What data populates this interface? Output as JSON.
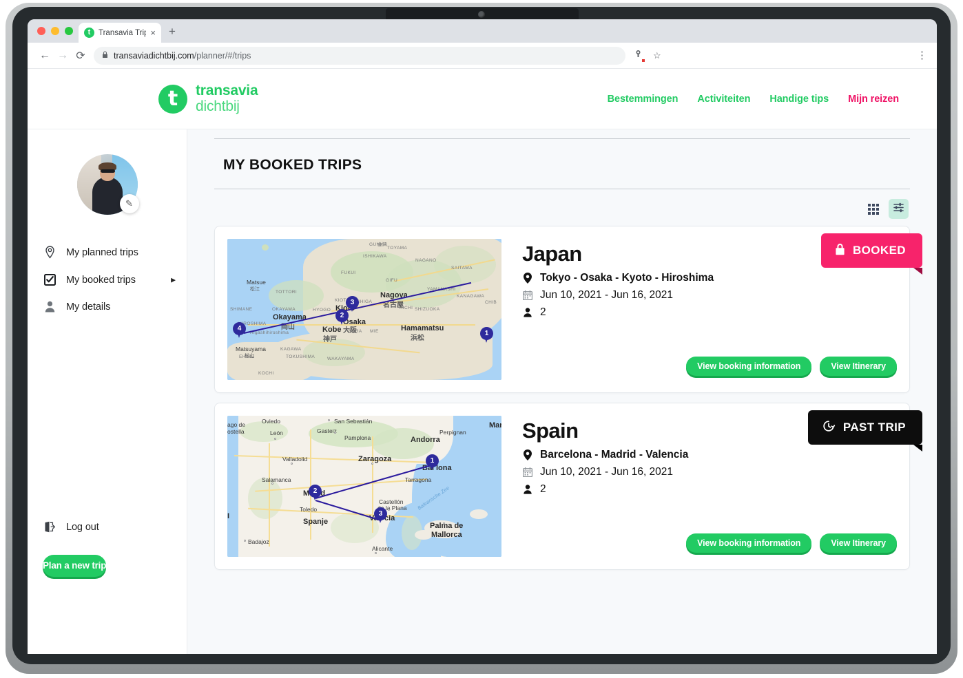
{
  "browser": {
    "tab_title": "Transavia Trip",
    "favicon_letter": "t",
    "tab_close": "×",
    "new_tab": "+",
    "back_icon": "←",
    "forward_icon": "→",
    "reload_icon": "⟳",
    "lock_icon": "🔒",
    "url_domain": "transaviadichtbij.com",
    "url_path": "/planner/#/trips",
    "star_icon": "☆",
    "menu_icon": "⋮"
  },
  "header": {
    "logo_line1": "transavia",
    "logo_line2": "dichtbij",
    "nav": [
      {
        "label": "Bestemmingen",
        "active": false
      },
      {
        "label": "Activiteiten",
        "active": false
      },
      {
        "label": "Handige tips",
        "active": false
      },
      {
        "label": "Mijn reizen",
        "active": true
      }
    ]
  },
  "sidebar": {
    "edit_icon": "✎",
    "items": [
      {
        "label": "My planned trips",
        "icon": "location-pin-icon",
        "arrow": ""
      },
      {
        "label": "My booked trips",
        "icon": "checkbox-checked-icon",
        "arrow": "▶"
      },
      {
        "label": "My details",
        "icon": "person-icon",
        "arrow": ""
      }
    ],
    "logout_label": "Log out",
    "plan_button": "Plan a new trip"
  },
  "main": {
    "page_title": "MY BOOKED TRIPS",
    "view_toggle": {
      "grid_label": "grid-view",
      "list_label": "list-view",
      "active": "list-view"
    },
    "trips": [
      {
        "name": "Japan",
        "places": "Tokyo - Osaka - Kyoto - Hiroshima",
        "dates": "Jun 10, 2021 - Jun 16, 2021",
        "travelers": "2",
        "status_label": "BOOKED",
        "status_type": "booked",
        "status_icon": "lock-icon",
        "buttons": {
          "booking": "View booking information",
          "itinerary": "View Itinerary"
        },
        "map": {
          "country_label": "",
          "markers": [
            {
              "n": "1",
              "city": "Tokyo"
            },
            {
              "n": "2",
              "city": "Osaka"
            },
            {
              "n": "3",
              "city": "Kyoto"
            },
            {
              "n": "4",
              "city": "Hiroshima"
            }
          ],
          "labels": [
            "TOYAMA",
            "ISHIKAWA",
            "NAGANO",
            "SAITAMA",
            "GUNMA",
            "FUKUI",
            "GIFU",
            "YAMANASHI",
            "KANAGAWA",
            "CHIBA",
            "SHIGA",
            "AICHI",
            "SHIZUOKA",
            "MIE",
            "NARA",
            "KYOTO",
            "HYOGO",
            "OKAYAMA",
            "TOTTORI",
            "SHIMANE",
            "HIROSHIMA",
            "KAGAWA",
            "TOKUSHIMA",
            "WAKAYAMA",
            "EHIME",
            "KOCHI",
            "MATSUYAMA"
          ],
          "cities": [
            "Matsue",
            "Okayama",
            "Kobe",
            "Nagoya",
            "Kioto",
            "Osaka",
            "Hamamatsu",
            "Matsuyama"
          ]
        }
      },
      {
        "name": "Spain",
        "places": "Barcelona - Madrid - Valencia",
        "dates": "Jun 10, 2021 - Jun 16, 2021",
        "travelers": "2",
        "status_label": "PAST TRIP",
        "status_type": "past",
        "status_icon": "history-clock-icon",
        "buttons": {
          "booking": "View booking information",
          "itinerary": "View Itinerary"
        },
        "map": {
          "country_label": "Spanje",
          "sea_label": "Balearische Zee",
          "markers": [
            {
              "n": "1",
              "city": "Barcelona"
            },
            {
              "n": "2",
              "city": "Madrid"
            },
            {
              "n": "3",
              "city": "Valencia"
            }
          ],
          "cities": [
            "Oviedo",
            "San Sebastián",
            "Gasteiz",
            "Pamplona",
            "Perpignan",
            "Andorra",
            "León",
            "Valladolid",
            "Zaragoza",
            "Tarragona",
            "Salamanca",
            "Castellón de la Plana",
            "Toledo",
            "Alicante",
            "Badajoz",
            "Palma de Mallorca",
            "Marse"
          ]
        }
      }
    ]
  },
  "colors": {
    "green": "#22cb63",
    "green_shadow": "#15a84d",
    "pink": "#ef1164",
    "badge_pink": "#f7236b",
    "badge_black": "#0d0d0d",
    "mint": "#c8ecdf",
    "route_blue": "#2b1b9e",
    "pin_blue": "#2e2a9c"
  }
}
